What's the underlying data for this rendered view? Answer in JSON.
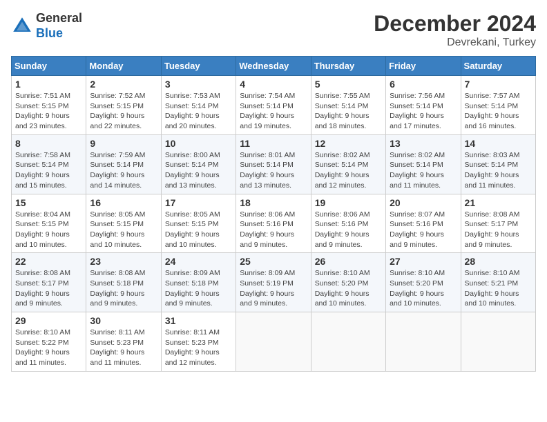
{
  "header": {
    "logo_line1": "General",
    "logo_line2": "Blue",
    "month": "December 2024",
    "location": "Devrekani, Turkey"
  },
  "weekdays": [
    "Sunday",
    "Monday",
    "Tuesday",
    "Wednesday",
    "Thursday",
    "Friday",
    "Saturday"
  ],
  "weeks": [
    [
      {
        "day": "1",
        "info": "Sunrise: 7:51 AM\nSunset: 5:15 PM\nDaylight: 9 hours\nand 23 minutes."
      },
      {
        "day": "2",
        "info": "Sunrise: 7:52 AM\nSunset: 5:15 PM\nDaylight: 9 hours\nand 22 minutes."
      },
      {
        "day": "3",
        "info": "Sunrise: 7:53 AM\nSunset: 5:14 PM\nDaylight: 9 hours\nand 20 minutes."
      },
      {
        "day": "4",
        "info": "Sunrise: 7:54 AM\nSunset: 5:14 PM\nDaylight: 9 hours\nand 19 minutes."
      },
      {
        "day": "5",
        "info": "Sunrise: 7:55 AM\nSunset: 5:14 PM\nDaylight: 9 hours\nand 18 minutes."
      },
      {
        "day": "6",
        "info": "Sunrise: 7:56 AM\nSunset: 5:14 PM\nDaylight: 9 hours\nand 17 minutes."
      },
      {
        "day": "7",
        "info": "Sunrise: 7:57 AM\nSunset: 5:14 PM\nDaylight: 9 hours\nand 16 minutes."
      }
    ],
    [
      {
        "day": "8",
        "info": "Sunrise: 7:58 AM\nSunset: 5:14 PM\nDaylight: 9 hours\nand 15 minutes."
      },
      {
        "day": "9",
        "info": "Sunrise: 7:59 AM\nSunset: 5:14 PM\nDaylight: 9 hours\nand 14 minutes."
      },
      {
        "day": "10",
        "info": "Sunrise: 8:00 AM\nSunset: 5:14 PM\nDaylight: 9 hours\nand 13 minutes."
      },
      {
        "day": "11",
        "info": "Sunrise: 8:01 AM\nSunset: 5:14 PM\nDaylight: 9 hours\nand 13 minutes."
      },
      {
        "day": "12",
        "info": "Sunrise: 8:02 AM\nSunset: 5:14 PM\nDaylight: 9 hours\nand 12 minutes."
      },
      {
        "day": "13",
        "info": "Sunrise: 8:02 AM\nSunset: 5:14 PM\nDaylight: 9 hours\nand 11 minutes."
      },
      {
        "day": "14",
        "info": "Sunrise: 8:03 AM\nSunset: 5:14 PM\nDaylight: 9 hours\nand 11 minutes."
      }
    ],
    [
      {
        "day": "15",
        "info": "Sunrise: 8:04 AM\nSunset: 5:15 PM\nDaylight: 9 hours\nand 10 minutes."
      },
      {
        "day": "16",
        "info": "Sunrise: 8:05 AM\nSunset: 5:15 PM\nDaylight: 9 hours\nand 10 minutes."
      },
      {
        "day": "17",
        "info": "Sunrise: 8:05 AM\nSunset: 5:15 PM\nDaylight: 9 hours\nand 10 minutes."
      },
      {
        "day": "18",
        "info": "Sunrise: 8:06 AM\nSunset: 5:16 PM\nDaylight: 9 hours\nand 9 minutes."
      },
      {
        "day": "19",
        "info": "Sunrise: 8:06 AM\nSunset: 5:16 PM\nDaylight: 9 hours\nand 9 minutes."
      },
      {
        "day": "20",
        "info": "Sunrise: 8:07 AM\nSunset: 5:16 PM\nDaylight: 9 hours\nand 9 minutes."
      },
      {
        "day": "21",
        "info": "Sunrise: 8:08 AM\nSunset: 5:17 PM\nDaylight: 9 hours\nand 9 minutes."
      }
    ],
    [
      {
        "day": "22",
        "info": "Sunrise: 8:08 AM\nSunset: 5:17 PM\nDaylight: 9 hours\nand 9 minutes."
      },
      {
        "day": "23",
        "info": "Sunrise: 8:08 AM\nSunset: 5:18 PM\nDaylight: 9 hours\nand 9 minutes."
      },
      {
        "day": "24",
        "info": "Sunrise: 8:09 AM\nSunset: 5:18 PM\nDaylight: 9 hours\nand 9 minutes."
      },
      {
        "day": "25",
        "info": "Sunrise: 8:09 AM\nSunset: 5:19 PM\nDaylight: 9 hours\nand 9 minutes."
      },
      {
        "day": "26",
        "info": "Sunrise: 8:10 AM\nSunset: 5:20 PM\nDaylight: 9 hours\nand 10 minutes."
      },
      {
        "day": "27",
        "info": "Sunrise: 8:10 AM\nSunset: 5:20 PM\nDaylight: 9 hours\nand 10 minutes."
      },
      {
        "day": "28",
        "info": "Sunrise: 8:10 AM\nSunset: 5:21 PM\nDaylight: 9 hours\nand 10 minutes."
      }
    ],
    [
      {
        "day": "29",
        "info": "Sunrise: 8:10 AM\nSunset: 5:22 PM\nDaylight: 9 hours\nand 11 minutes."
      },
      {
        "day": "30",
        "info": "Sunrise: 8:11 AM\nSunset: 5:23 PM\nDaylight: 9 hours\nand 11 minutes."
      },
      {
        "day": "31",
        "info": "Sunrise: 8:11 AM\nSunset: 5:23 PM\nDaylight: 9 hours\nand 12 minutes."
      },
      null,
      null,
      null,
      null
    ]
  ]
}
